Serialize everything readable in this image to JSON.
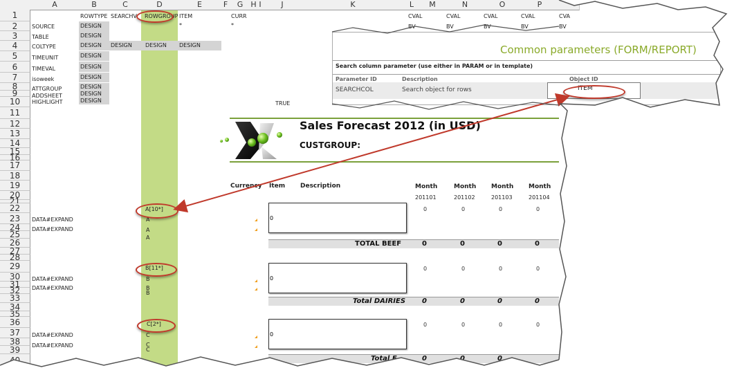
{
  "columns": [
    "A",
    "B",
    "C",
    "D",
    "E",
    "F",
    "G",
    "H",
    "I",
    "J",
    "K",
    "L",
    "M",
    "N",
    "O",
    "P"
  ],
  "rows": [
    "1",
    "2",
    "3",
    "4",
    "5",
    "6",
    "7",
    "8",
    "9",
    "10",
    "11",
    "12",
    "13",
    "14",
    "15",
    "16",
    "17",
    "18",
    "19",
    "20",
    "21",
    "22",
    "23",
    "24",
    "25",
    "26",
    "27",
    "28",
    "29",
    "30",
    "31",
    "32",
    "33",
    "34",
    "35",
    "36",
    "37",
    "38",
    "39",
    "40"
  ],
  "row1": {
    "rowtype": "ROWTYPE",
    "searchcol": "SEARCHV",
    "rowgroup": "ROWGROUP",
    "item": "ITEM",
    "curr": "CURR",
    "cval": [
      "CVAL",
      "CVAL",
      "CVAL",
      "CVAL",
      "CVA"
    ]
  },
  "row2": {
    "source_label": "SOURCE",
    "design": "DESIGN",
    "star1": "*",
    "star2": "*",
    "bv": [
      "BV",
      "BV",
      "BV",
      "BV",
      "BV"
    ]
  },
  "row3": {
    "label": "TABLE",
    "design": "DESIGN"
  },
  "row4": {
    "label": "COLTYPE",
    "design": [
      "DESIGN",
      "DESIGN",
      "DESIGN",
      "DESIGN"
    ]
  },
  "row5": {
    "label": "TIMEUNIT",
    "design": "DESIGN"
  },
  "row6": {
    "label": "TIMEVAL",
    "design": "DESIGN"
  },
  "row7": {
    "label": "isoweek",
    "design": "DESIGN"
  },
  "row8": {
    "label": "ATTGROUP",
    "design": "DESIGN"
  },
  "row9": {
    "label": "ADDSHEET",
    "design": "DESIGN"
  },
  "row10": {
    "label": "HIGHLIGHT",
    "design": "DESIGN",
    "true_value": "TRUE"
  },
  "param_panel": {
    "title": "Common parameters (FORM/REPORT)",
    "search_caption": "Search column parameter (use either in PARAM or in template)",
    "headers": {
      "param_id": "Parameter ID",
      "description": "Description",
      "object_id": "Object ID"
    },
    "row": {
      "param_id": "SEARCHCOL",
      "description": "Search object for rows",
      "object_id": "ITEM"
    }
  },
  "report": {
    "title": "Sales Forecast 2012 (in USD)",
    "subtitle": "CUSTGROUP:",
    "col_headers": {
      "currency": "Currency",
      "item": "Item",
      "description": "Description"
    },
    "months": [
      {
        "label": "Month",
        "period": "201101"
      },
      {
        "label": "Month",
        "period": "201102"
      },
      {
        "label": "Month",
        "period": "201103"
      },
      {
        "label": "Month",
        "period": "201104"
      }
    ],
    "next_period_fragment": "2",
    "zero": "0",
    "groups": [
      {
        "marker": "A[10*]",
        "rowgroup": [
          "A",
          "A",
          "A"
        ],
        "expand": [
          "DATA#EXPAND",
          "DATA#EXPAND"
        ],
        "box_value": "0",
        "total_label": "TOTAL BEEF"
      },
      {
        "marker": "B[11*]",
        "rowgroup": [
          "B",
          "B",
          "B"
        ],
        "expand": [
          "DATA#EXPAND",
          "DATA#EXPAND"
        ],
        "box_value": "0",
        "total_label": "Total DAIRIES"
      },
      {
        "marker": "C[2*]",
        "rowgroup": [
          "C",
          "C",
          "C"
        ],
        "expand": [
          "DATA#EXPAND",
          "DATA#EXPAND"
        ],
        "box_value": "0",
        "total_label": "Total F"
      }
    ]
  },
  "colors": {
    "green_column": "#c3db86",
    "accent_red": "#c0392b",
    "panel_title": "#8aaa2a",
    "design_gray": "#d4d4d4"
  },
  "icons": [
    "logo-icon",
    "orange-triangle-marker"
  ]
}
